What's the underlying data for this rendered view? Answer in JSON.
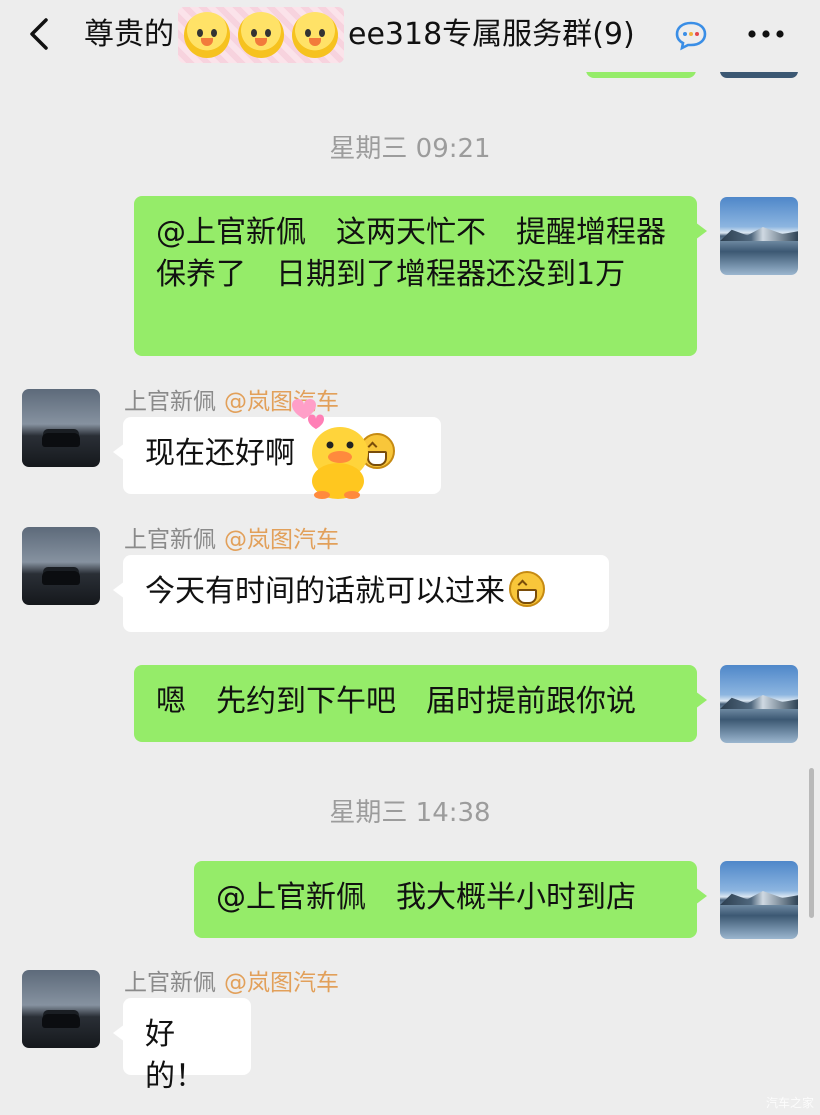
{
  "header": {
    "title_prefix": "尊贵的",
    "title_suffix": "ee318专属服务群",
    "member_count": "(9)",
    "back_icon": "chevron-left-icon",
    "more_icon": "more-dots-icon"
  },
  "messages": [
    {
      "type": "time",
      "text": "星期三 09:21"
    },
    {
      "type": "out",
      "text": "@上官新佩　这两天忙不　提醒增程器保养了　日期到了增程器还没到1万"
    },
    {
      "type": "in",
      "sender": "上官新佩",
      "org": "@岚图汽车",
      "text": "现在还好啊"
    },
    {
      "type": "in",
      "sender": "上官新佩",
      "org": "@岚图汽车",
      "text": "今天有时间的话就可以过来"
    },
    {
      "type": "out",
      "text": "嗯　先约到下午吧　届时提前跟你说"
    },
    {
      "type": "time",
      "text": "星期三 14:38"
    },
    {
      "type": "out",
      "text": "@上官新佩　我大概半小时到店"
    },
    {
      "type": "in",
      "sender": "上官新佩",
      "org": "@岚图汽车",
      "text": "好的！"
    }
  ],
  "watermark": "汽车之家",
  "colors": {
    "background": "#ededed",
    "outgoing_bubble": "#95ec69",
    "incoming_bubble": "#ffffff",
    "org_label": "#e2a05a"
  }
}
